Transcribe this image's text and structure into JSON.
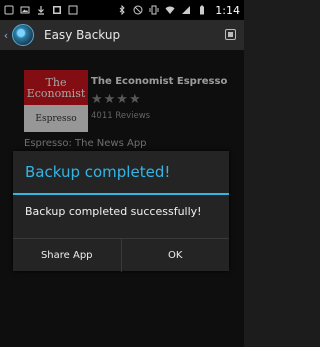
{
  "statusbar": {
    "left_icons": [
      "app-icon",
      "image-icon",
      "download-icon",
      "photo-icon",
      "box-icon"
    ],
    "right_icons": [
      "bluetooth-icon",
      "do-not-disturb-icon",
      "vibrate-icon",
      "wifi-icon",
      "signal-icon",
      "battery-icon"
    ],
    "time": "1:14"
  },
  "actionbar": {
    "title": "Easy Backup"
  },
  "app_card": {
    "logo_top_line1": "The",
    "logo_top_line2": "Economist",
    "logo_bottom": "Espresso",
    "name": "The Economist Espresso",
    "stars": "★★★★",
    "reviews": "4011 Reviews",
    "subtitle": "Espresso: The News App"
  },
  "dialog": {
    "title": "Backup completed!",
    "message": "Backup completed successfully!",
    "share_button": "Share App",
    "ok_button": "OK"
  },
  "colors": {
    "accent": "#33b5e5",
    "logo_red": "#c8141c"
  }
}
